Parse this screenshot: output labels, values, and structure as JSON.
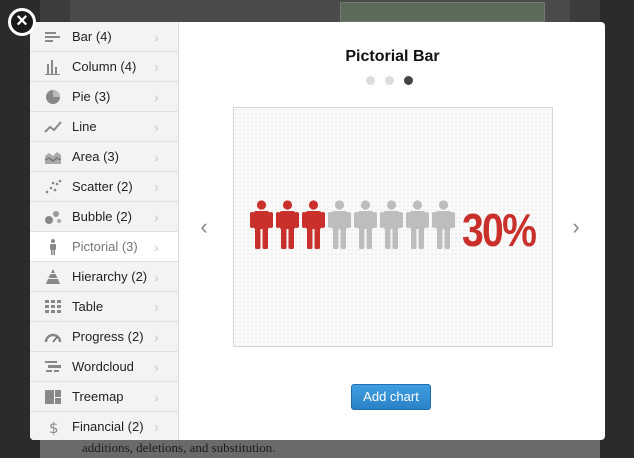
{
  "background": {
    "footer_text": "additions, deletions, and substitution."
  },
  "close_label": "×",
  "sidebar": {
    "items": [
      {
        "label": "Bar (4)",
        "icon": "bar-chart-icon",
        "active": false
      },
      {
        "label": "Column (4)",
        "icon": "column-chart-icon",
        "active": false
      },
      {
        "label": "Pie (3)",
        "icon": "pie-chart-icon",
        "active": false
      },
      {
        "label": "Line",
        "icon": "line-chart-icon",
        "active": false
      },
      {
        "label": "Area (3)",
        "icon": "area-chart-icon",
        "active": false
      },
      {
        "label": "Scatter (2)",
        "icon": "scatter-chart-icon",
        "active": false
      },
      {
        "label": "Bubble (2)",
        "icon": "bubble-chart-icon",
        "active": false
      },
      {
        "label": "Pictorial (3)",
        "icon": "pictorial-person-icon",
        "active": true
      },
      {
        "label": "Hierarchy (2)",
        "icon": "hierarchy-pyramid-icon",
        "active": false
      },
      {
        "label": "Table",
        "icon": "table-grid-icon",
        "active": false
      },
      {
        "label": "Progress (2)",
        "icon": "progress-gauge-icon",
        "active": false
      },
      {
        "label": "Wordcloud",
        "icon": "wordcloud-icon",
        "active": false
      },
      {
        "label": "Treemap",
        "icon": "treemap-icon",
        "active": false
      },
      {
        "label": "Financial (2)",
        "icon": "dollar-icon",
        "active": false
      }
    ],
    "chevron": "›"
  },
  "preview": {
    "title": "Pictorial Bar",
    "page_indicator": {
      "count": 3,
      "current": 3
    },
    "prev_arrow": "‹",
    "next_arrow": "›",
    "pictorial": {
      "total_figures": 8,
      "highlighted_figures": 3,
      "highlight_color": "#c9302c",
      "base_color": "#bdbdbd",
      "value_text": "30%"
    }
  },
  "add_button": {
    "label": "Add chart"
  },
  "colors": {
    "accent": "#2a82c6",
    "value_red": "#c9302c"
  }
}
